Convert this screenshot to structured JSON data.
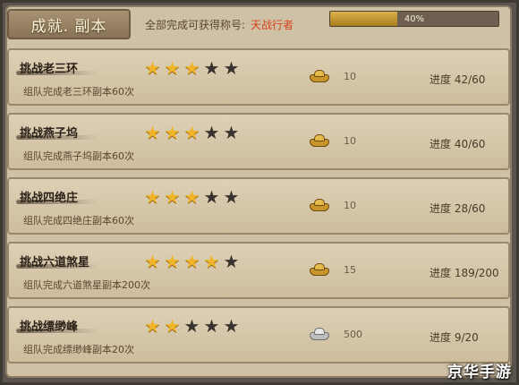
{
  "header": {
    "title": "成就. 副本",
    "note": "全部完成可获得称号:",
    "honor_title": "天战行者",
    "total_progress_label": "40%",
    "total_progress_fraction": 0.4
  },
  "achievements": [
    {
      "title": "挑战老三环",
      "desc": "组队完成老三环副本60次",
      "stars_filled": 3,
      "stars_total": 5,
      "reward_icon": "gold-ingot-icon",
      "reward_amount": "10",
      "progress": "进度 42/60"
    },
    {
      "title": "挑战燕子坞",
      "desc": "组队完成燕子坞副本60次",
      "stars_filled": 3,
      "stars_total": 5,
      "reward_icon": "gold-ingot-icon",
      "reward_amount": "10",
      "progress": "进度 40/60"
    },
    {
      "title": "挑战四绝庄",
      "desc": "组队完成四绝庄副本60次",
      "stars_filled": 3,
      "stars_total": 5,
      "reward_icon": "gold-ingot-icon",
      "reward_amount": "10",
      "progress": "进度 28/60"
    },
    {
      "title": "挑战六道煞星",
      "desc": "组队完成六道煞星副本200次",
      "stars_filled": 4,
      "stars_total": 5,
      "reward_icon": "gold-ingot-icon",
      "reward_amount": "15",
      "progress": "进度 189/200"
    },
    {
      "title": "挑战缥缈峰",
      "desc": "组队完成缥缈峰副本20次",
      "stars_filled": 2,
      "stars_total": 5,
      "reward_icon": "silver-ingot-icon",
      "reward_amount": "500",
      "progress": "进度 9/20"
    }
  ],
  "watermark": "京华手游",
  "colors": {
    "honor": "#d8431c",
    "star_on": "#f0b428",
    "star_off": "#3a3430",
    "progress_fill": "#c99a34"
  }
}
